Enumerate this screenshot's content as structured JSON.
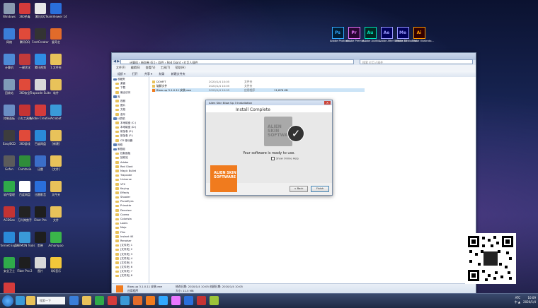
{
  "desktop": {
    "icons": [
      {
        "label": "Windows",
        "color": "#8a9bb0"
      },
      {
        "label": "360杀毒",
        "color": "#d43b3b"
      },
      {
        "label": "腾讯QQ",
        "color": "#e8e8e8"
      },
      {
        "label": "TeamViewer 14",
        "color": "#2a6fdb"
      },
      {
        "label": "网络",
        "color": "#3a7ed8"
      },
      {
        "label": "腾讯QQ",
        "color": "#e04a3a"
      },
      {
        "label": "FontCreator",
        "color": "#333333"
      },
      {
        "label": "爱奇艺",
        "color": "#e26b2a"
      },
      {
        "label": "计算机",
        "color": "#4d8ad6"
      },
      {
        "label": "一键优化",
        "color": "#c23a3a"
      },
      {
        "label": "腾讯视频",
        "color": "#2f8de4"
      },
      {
        "label": "1.文件夹",
        "color": "#e8c25a"
      },
      {
        "label": "回收站",
        "color": "#7f9bb8"
      },
      {
        "label": "360安全",
        "color": "#e04a3a"
      },
      {
        "label": "Trapcode Suite",
        "color": "#d8d8d8"
      },
      {
        "label": "软件",
        "color": "#e8c25a"
      },
      {
        "label": "控制面板",
        "color": "#6a8ec4"
      },
      {
        "label": "小丸工具箱",
        "color": "#c43333"
      },
      {
        "label": "Adobe Creative",
        "color": "#d43b3b"
      },
      {
        "label": "Acrobat",
        "color": "#3a9ad8"
      },
      {
        "label": "EasyBCD",
        "color": "#3d3d3d"
      },
      {
        "label": "360游戏",
        "color": "#e04a3a"
      },
      {
        "label": "百度网盘",
        "color": "#2a8ad8"
      },
      {
        "label": "[新建]",
        "color": "#e8c25a"
      },
      {
        "label": "Gofon",
        "color": "#5b5b5b"
      },
      {
        "label": "Camtasia",
        "color": "#2f8d3a"
      },
      {
        "label": "迅雷",
        "color": "#3b6ec8"
      },
      {
        "label": "[文件]",
        "color": "#e8c25a"
      },
      {
        "label": "软件管理",
        "color": "#2faa4a"
      },
      {
        "label": "百度网盘",
        "color": "#ffffff"
      },
      {
        "label": "迅雷影音",
        "color": "#2a6fdb"
      },
      {
        "label": "文件夹",
        "color": "#e8c25a"
      },
      {
        "label": "ACDSee",
        "color": "#c43333"
      },
      {
        "label": "万兴神剪手",
        "color": "#222222"
      },
      {
        "label": "Fiber Pro",
        "color": "#1e1e1e"
      },
      {
        "label": "文件",
        "color": "#e8c25a"
      },
      {
        "label": "Internet Explorer",
        "color": "#2a8ad8"
      },
      {
        "label": "DAEMON Tools",
        "color": "#3a9ad8"
      },
      {
        "label": "剪映",
        "color": "#1e1e1e"
      },
      {
        "label": "Ashampoo",
        "color": "#3ab54a"
      },
      {
        "label": "安全卫士",
        "color": "#2faa4a"
      },
      {
        "label": "Fiber Pro 2",
        "color": "#1e1e1e"
      },
      {
        "label": "图片",
        "color": "#d8d8d8"
      },
      {
        "label": "QQ音乐",
        "color": "#f2c73a"
      },
      {
        "label": "Airship Elna Pro 3",
        "color": "#d43b3b"
      }
    ],
    "adobe": [
      {
        "abbr": "Ps",
        "label": "Adobe Photosh...",
        "color": "#31a8ff",
        "bg": "#001e36"
      },
      {
        "abbr": "Pr",
        "label": "Adobe Premie...",
        "color": "#ea77ff",
        "bg": "#2a0634"
      },
      {
        "abbr": "Au",
        "label": "Adobe Auditi...",
        "color": "#00e4bb",
        "bg": "#002922"
      },
      {
        "abbr": "Ae",
        "label": "Adobe After Effects CC",
        "color": "#9999ff",
        "bg": "#00005b"
      },
      {
        "abbr": "Me",
        "label": "Adobe Media Enc...",
        "color": "#9999ff",
        "bg": "#00005b"
      },
      {
        "abbr": "Ai",
        "label": "Adobe Illustrato...",
        "color": "#ff9a00",
        "bg": "#330000"
      }
    ]
  },
  "explorer": {
    "address": "计算机 › 新加卷 (E:) › 软件 › Red Giant › 红巨人插件",
    "search_placeholder": "搜索 红巨人插件",
    "menu": [
      "文件(F)",
      "编辑(E)",
      "查看(V)",
      "工具(T)",
      "帮助(H)"
    ],
    "toolbar": [
      "组织 ▾",
      "打开",
      "共享 ▾",
      "刻录",
      "新建文件夹"
    ],
    "nav_items": [
      "收藏夹",
      "桌面",
      "下载",
      "最近访问",
      "库",
      "视频",
      "图片",
      "文档",
      "音乐",
      "计算机",
      "本地磁盘 (C:)",
      "本地磁盘 (D:)",
      "新加卷 (E:)",
      "新加卷 (F:)",
      "CD 驱动器",
      "网络",
      "家庭组",
      "控制面板",
      "回收站",
      "Adobe",
      "Red Giant",
      "Magic Bullet",
      "Trapcode",
      "Universe",
      "VFX",
      "Keying",
      "Effects",
      "Shooter",
      "PluralEyes",
      "Primatte",
      "Denoiser",
      "Cosmo",
      "Colorista",
      "Looks",
      "Mojo",
      "Film",
      "Instant 4K",
      "Renoiser",
      "[文件夹] 1",
      "[文件夹] 2",
      "[文件夹] 3",
      "[文件夹] 4",
      "[文件夹] 5",
      "[文件夹] 6",
      "[文件夹] 7",
      "[文件夹] 8"
    ],
    "files": [
      {
        "name": "DOMFT",
        "date": "2020/1/4 10:05",
        "type": "文件夹",
        "size": ""
      },
      {
        "name": "破解文件",
        "date": "2020/1/4 10:05",
        "type": "文件夹",
        "size": ""
      },
      {
        "name": "Blow-up 3.1.0.11 安装.exe",
        "date": "2020/1/4 10:05",
        "type": "应用程序",
        "size": "11,876 KB"
      }
    ],
    "status_name": "Blow-up 3.1.0.11 安装.exe",
    "status_detail": "修改日期: 2020/1/4 10:05  创建日期: 2020/1/4 10:05",
    "status_type": "应用程序",
    "status_size": "大小: 11.5 MB"
  },
  "dialog": {
    "title": "Alien Skin Blow Up 3 Installation",
    "heading": "Install Complete",
    "box_label": "ALIEN SKIN SOFTWARE",
    "ready_text": "Your software is ready to use.",
    "checkbox_label": "Show Online Help",
    "logo_text": "ALIEN SKIN SOFTWARE",
    "back_button": "< Back",
    "finish_button": "Finish"
  },
  "taskbar": {
    "search_placeholder": "搜索一下",
    "tray_line1": "ATC",
    "tray_line2": "中 ▲",
    "clock_time": "10:09",
    "clock_date": "2020/1/4"
  },
  "colors": {
    "accent": "#2a6fdb",
    "dialog_logo": "#f07b1e"
  }
}
